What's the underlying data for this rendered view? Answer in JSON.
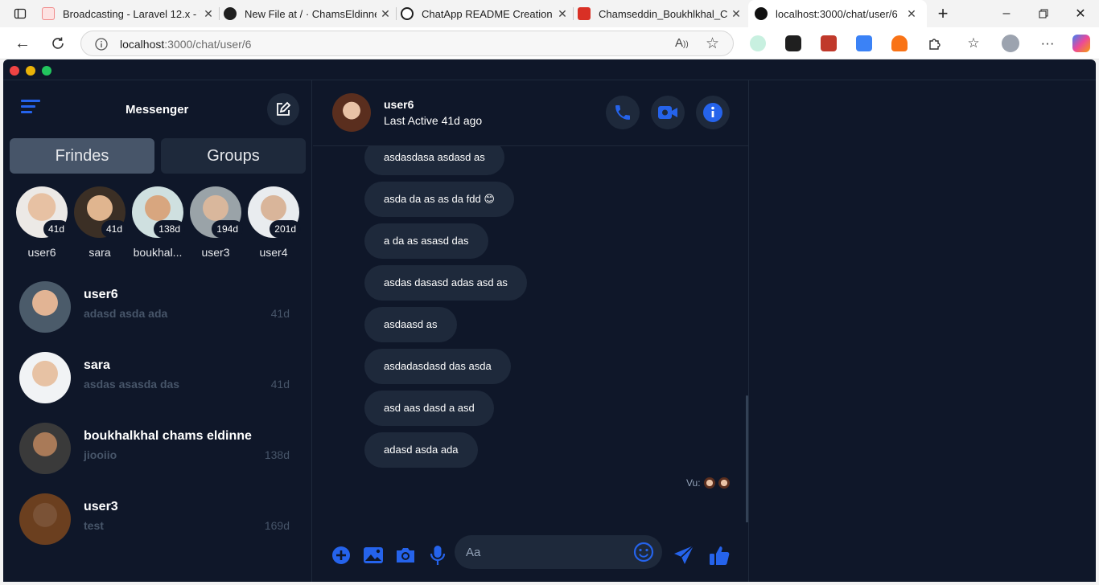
{
  "browser": {
    "tabs": [
      {
        "title": "Broadcasting - Laravel 12.x - T"
      },
      {
        "title": "New File at / · ChamsEldinne/"
      },
      {
        "title": "ChatApp README Creation"
      },
      {
        "title": "Chamseddin_Boukhlkhal_CV.p"
      },
      {
        "title": "localhost:3000/chat/user/6"
      }
    ],
    "url_host": "localhost",
    "url_rest": ":3000/chat/user/6"
  },
  "sidebar": {
    "title": "Messenger",
    "segments": {
      "friends": "Frindes",
      "groups": "Groups"
    },
    "stories": [
      {
        "name": "user6",
        "badge": "41d"
      },
      {
        "name": "sara",
        "badge": "41d"
      },
      {
        "name": "boukhal...",
        "badge": "138d"
      },
      {
        "name": "user3",
        "badge": "194d"
      },
      {
        "name": "user4",
        "badge": "201d"
      }
    ],
    "conversations": [
      {
        "name": "user6",
        "preview": "adasd asda ada",
        "time": "41d"
      },
      {
        "name": "sara",
        "preview": "asdas asasda das",
        "time": "41d"
      },
      {
        "name": "boukhalkhal chams eldinne",
        "preview": "jiooiio",
        "time": "138d"
      },
      {
        "name": "user3",
        "preview": "test",
        "time": "169d"
      }
    ]
  },
  "chat": {
    "name": "user6",
    "status": "Last Active 41d ago",
    "messages": [
      "asdasdasa asdasd as",
      "asda da as as da fdd 😊",
      "a da as asasd das",
      "asdas dasasd adas asd as",
      "asdaasd as",
      "asdadasdasd das asda",
      "asd aas dasd a asd",
      "adasd asda ada"
    ],
    "seen_label": "Vu:",
    "input_placeholder": "Aa"
  },
  "colors": {
    "background": "#0f1729",
    "surface": "#1e293b",
    "accent": "#2563eb",
    "muted": "#475569"
  }
}
